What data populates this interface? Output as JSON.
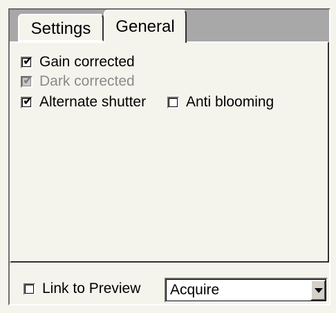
{
  "tabs": [
    {
      "label": "Settings",
      "active": false
    },
    {
      "label": "General",
      "active": true
    }
  ],
  "options": {
    "gain_corrected": {
      "label": "Gain corrected",
      "checked": true,
      "enabled": true
    },
    "dark_corrected": {
      "label": "Dark corrected",
      "checked": true,
      "enabled": false
    },
    "alternate_shutter": {
      "label": "Alternate shutter",
      "checked": true,
      "enabled": true
    },
    "anti_blooming": {
      "label": "Anti blooming",
      "checked": false,
      "enabled": true
    }
  },
  "footer": {
    "link_to_preview": {
      "label": "Link to Preview",
      "checked": false
    },
    "mode_select": {
      "value": "Acquire"
    }
  },
  "icons": {
    "check": "✔",
    "dropdown": "chevron-down-icon"
  }
}
